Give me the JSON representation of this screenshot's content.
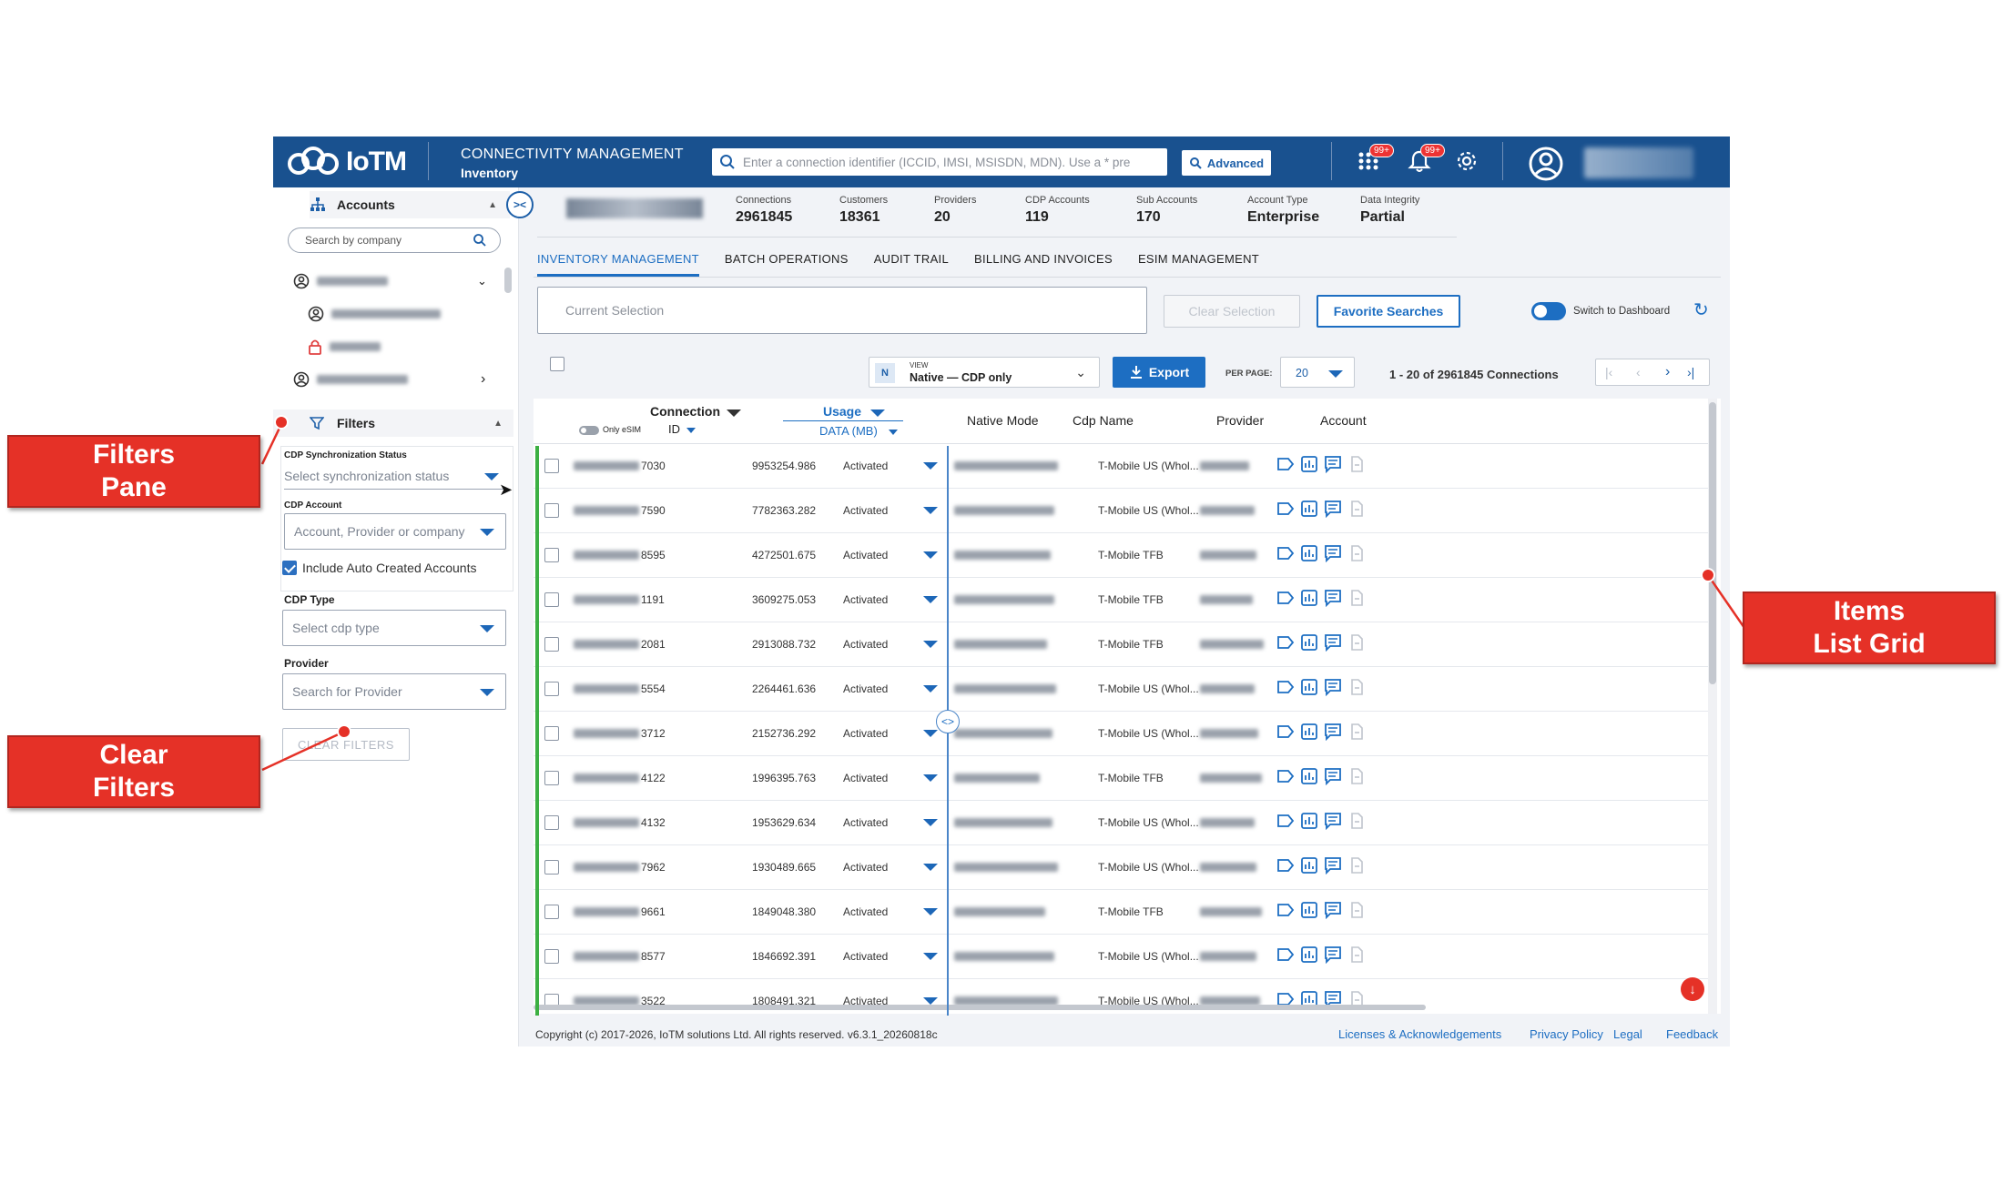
{
  "header": {
    "logo": "IoTM",
    "title": "CONNECTIVITY MANAGEMENT",
    "subtitle": "Inventory",
    "search_placeholder": "Enter a connection identifier (ICCID, IMSI, MSISDN, MDN). Use a * pre",
    "advanced_label": "Advanced",
    "apps_badge": "99+",
    "notif_badge": "99+"
  },
  "sidebar": {
    "accounts_label": "Accounts",
    "search_placeholder": "Search by company",
    "filters_label": "Filters",
    "sync_status_label": "CDP Synchronization Status",
    "sync_status_placeholder": "Select synchronization status",
    "cdp_account_label": "CDP Account",
    "cdp_account_placeholder": "Account, Provider or company",
    "include_auto_label": "Include Auto Created Accounts",
    "cdp_type_label": "CDP Type",
    "cdp_type_placeholder": "Select cdp type",
    "provider_label": "Provider",
    "provider_placeholder": "Search for Provider",
    "clear_filters": "CLEAR FILTERS"
  },
  "stats": [
    {
      "label": "Connections",
      "value": "2961845"
    },
    {
      "label": "Customers",
      "value": "18361"
    },
    {
      "label": "Providers",
      "value": "20"
    },
    {
      "label": "CDP Accounts",
      "value": "119"
    },
    {
      "label": "Sub Accounts",
      "value": "170"
    },
    {
      "label": "Account Type",
      "value": "Enterprise"
    },
    {
      "label": "Data Integrity",
      "value": "Partial"
    }
  ],
  "tabs": [
    "INVENTORY MANAGEMENT",
    "BATCH OPERATIONS",
    "AUDIT TRAIL",
    "BILLING AND INVOICES",
    "ESIM MANAGEMENT"
  ],
  "toolbar": {
    "current_selection": "Current Selection",
    "clear_selection": "Clear Selection",
    "favorite_searches": "Favorite Searches",
    "switch_dashboard": "Switch to Dashboard",
    "view_badge": "N",
    "view_small": "VIEW",
    "view_value": "Native — CDP only",
    "export": "Export",
    "per_page_label": "PER PAGE:",
    "per_page_value": "20",
    "pagination": "1 - 20 of 2961845 Connections"
  },
  "grid": {
    "col_connection": "Connection",
    "col_only_esim": "Only eSIM",
    "col_id": "ID",
    "col_usage": "Usage",
    "col_data": "DATA (MB)",
    "col_native_mode": "Native Mode",
    "col_cdp_name": "Cdp Name",
    "col_provider": "Provider",
    "col_account": "Account",
    "rows": [
      {
        "id": "7030",
        "usage": "9953254.986",
        "mode": "Activated",
        "provider": "T-Mobile US (Whol..."
      },
      {
        "id": "7590",
        "usage": "7782363.282",
        "mode": "Activated",
        "provider": "T-Mobile US (Whol..."
      },
      {
        "id": "8595",
        "usage": "4272501.675",
        "mode": "Activated",
        "provider": "T-Mobile TFB"
      },
      {
        "id": "1191",
        "usage": "3609275.053",
        "mode": "Activated",
        "provider": "T-Mobile TFB"
      },
      {
        "id": "2081",
        "usage": "2913088.732",
        "mode": "Activated",
        "provider": "T-Mobile TFB"
      },
      {
        "id": "5554",
        "usage": "2264461.636",
        "mode": "Activated",
        "provider": "T-Mobile US (Whol..."
      },
      {
        "id": "3712",
        "usage": "2152736.292",
        "mode": "Activated",
        "provider": "T-Mobile US (Whol..."
      },
      {
        "id": "4122",
        "usage": "1996395.763",
        "mode": "Activated",
        "provider": "T-Mobile TFB"
      },
      {
        "id": "4132",
        "usage": "1953629.634",
        "mode": "Activated",
        "provider": "T-Mobile US (Whol..."
      },
      {
        "id": "7962",
        "usage": "1930489.665",
        "mode": "Activated",
        "provider": "T-Mobile US (Whol..."
      },
      {
        "id": "9661",
        "usage": "1849048.380",
        "mode": "Activated",
        "provider": "T-Mobile TFB"
      },
      {
        "id": "8577",
        "usage": "1846692.391",
        "mode": "Activated",
        "provider": "T-Mobile US (Whol..."
      },
      {
        "id": "3522",
        "usage": "1808491.321",
        "mode": "Activated",
        "provider": "T-Mobile US (Whol..."
      }
    ]
  },
  "footer": {
    "copyright": "Copyright (c) 2017-2026, IoTM solutions Ltd. All rights reserved. v6.3.1_20260818c",
    "licenses": "Licenses & Acknowledgements",
    "privacy": "Privacy Policy",
    "legal": "Legal",
    "feedback": "Feedback"
  },
  "callouts": {
    "filters_pane_line1": "Filters",
    "filters_pane_line2": "Pane",
    "clear_filters_line1": "Clear",
    "clear_filters_line2": "Filters",
    "items_grid_line1": "Items",
    "items_grid_line2": "List Grid"
  },
  "colors": {
    "header": "#19518f",
    "accent": "#1d6ec2",
    "callout": "#e53127",
    "active_strip": "#3cb043"
  }
}
